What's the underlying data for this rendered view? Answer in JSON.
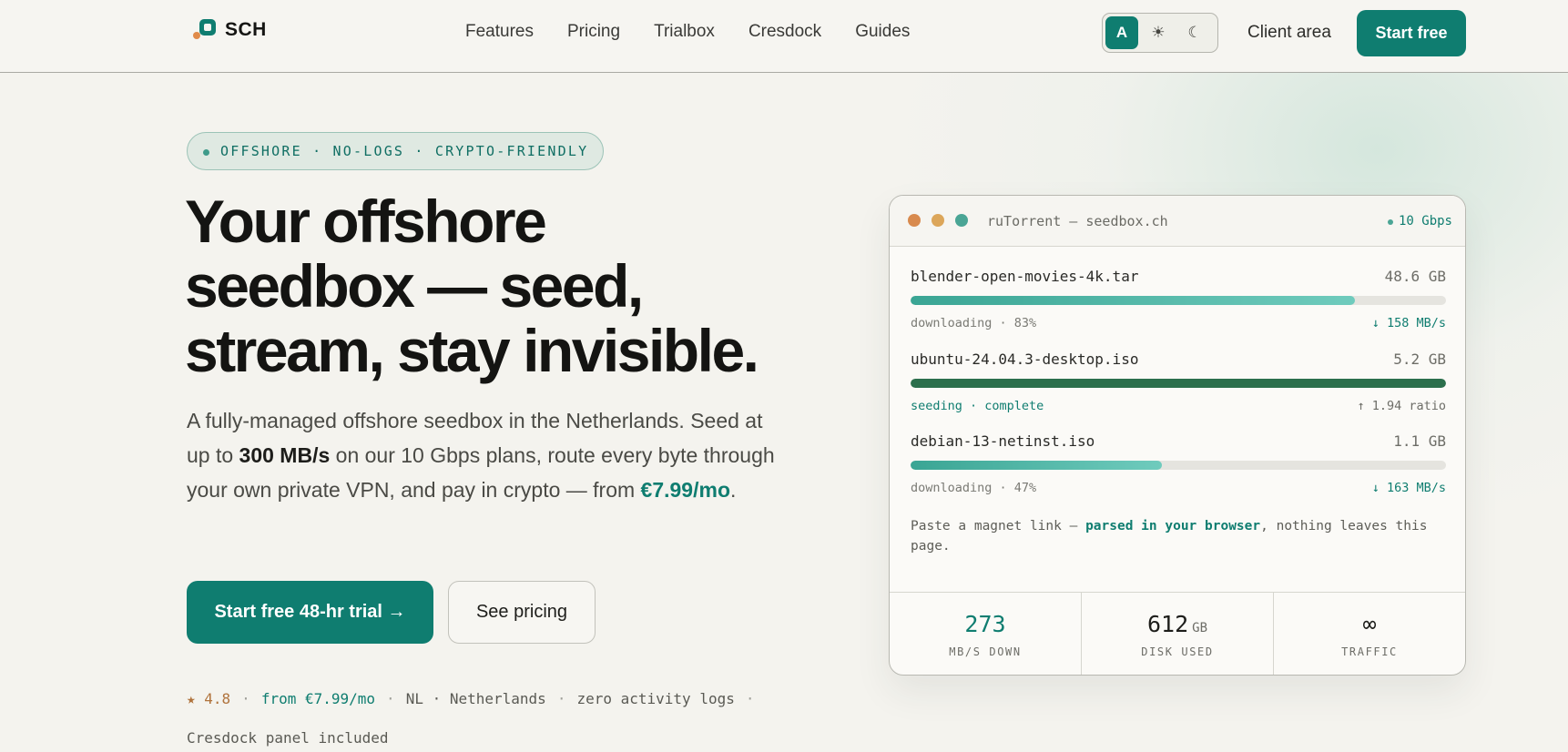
{
  "brand": {
    "name": "SCH"
  },
  "nav": {
    "items": [
      {
        "label": "Features"
      },
      {
        "label": "Pricing"
      },
      {
        "label": "Trialbox"
      },
      {
        "label": "Cresdock"
      },
      {
        "label": "Guides"
      }
    ],
    "theme": {
      "auto_label": "A",
      "light_icon": "☀",
      "dark_icon": "☾",
      "selected": "auto"
    },
    "client_area": "Client area",
    "start_free": "Start free"
  },
  "hero": {
    "pill": "OFFSHORE · NO-LOGS · CRYPTO-FRIENDLY",
    "headline_line1": "Your offshore",
    "headline_line2": "seedbox — seed,",
    "headline_line3": "stream, stay invisible.",
    "lede_part1": "A fully-managed offshore seedbox in the Netherlands. Seed at up to ",
    "lede_strong": "300 MB/s",
    "lede_part2": " on our 10 Gbps plans, route every byte through your own private VPN, and pay in crypto — from ",
    "lede_price": "€7.99/mo",
    "lede_end": ".",
    "cta_primary": "Start free 48-hr trial →",
    "cta_secondary": "See pricing",
    "meta": {
      "rating": "★ 4.8",
      "from_price": "from €7.99/mo",
      "location": "NL · Netherlands",
      "logs": "zero activity logs",
      "panel": "Cresdock panel included",
      "separator": "·"
    }
  },
  "terminal": {
    "dot_colors": [
      "#d88a4e",
      "#dca65a",
      "#4aa595"
    ],
    "title": "ruTorrent — seedbox.ch",
    "speed": "10 Gbps",
    "torrents": [
      {
        "name": "blender-open-movies-4k.tar",
        "size": "48.6 GB",
        "status": "downloading · 83%",
        "rate": "↓ 158 MB/s",
        "progress": 0.83,
        "complete": false
      },
      {
        "name": "ubuntu-24.04.3-desktop.iso",
        "size": "5.2 GB",
        "status": "seeding · complete",
        "rate": "↑ 1.94 ratio",
        "progress": 1.0,
        "complete": true
      },
      {
        "name": "debian-13-netinst.iso",
        "size": "1.1 GB",
        "status": "downloading · 47%",
        "rate": "↓ 163 MB/s",
        "progress": 0.47,
        "complete": false
      }
    ],
    "magnet_before": "Paste a magnet link — ",
    "magnet_bold": "parsed in your browser",
    "magnet_after": ", nothing leaves this page.",
    "stats": [
      {
        "value": "273",
        "unit": "",
        "label": "MB/S DOWN"
      },
      {
        "value": "612",
        "unit": "GB",
        "label": "DISK USED"
      },
      {
        "value": "∞",
        "unit": "",
        "label": "TRAFFIC"
      }
    ]
  }
}
